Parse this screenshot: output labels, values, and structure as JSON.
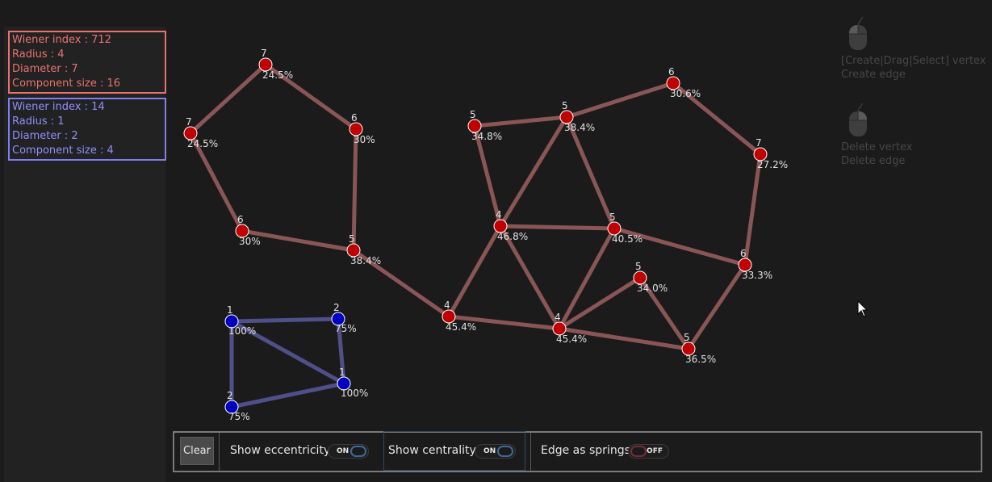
{
  "stats": {
    "red": {
      "wiener_index": "Wiener index : 712",
      "radius": "Radius : 4",
      "diameter": "Diameter : 7",
      "component_size": "Component size : 16",
      "color": "#e8736e"
    },
    "blue": {
      "wiener_index": "Wiener index : 14",
      "radius": "Radius : 1",
      "diameter": "Diameter : 2",
      "component_size": "Component size : 4",
      "color": "#8f8fff"
    }
  },
  "help": {
    "left_click_lines": [
      "[Create|Drag|Select] vertex",
      "Create edge"
    ],
    "right_click_lines": [
      "Delete vertex",
      "Delete edge"
    ]
  },
  "toolbar": {
    "clear_label": "Clear",
    "eccentricity": {
      "label": "Show eccentricity",
      "state": "ON"
    },
    "centrality": {
      "label": "Show centrality",
      "state": "ON"
    },
    "springs": {
      "label": "Edge as springs",
      "state": "OFF"
    }
  },
  "colors": {
    "red_vertex": "#c00000",
    "blue_vertex": "#0000c0",
    "red_edge": "#8a5555",
    "blue_edge": "#4f4f8a"
  },
  "graph": {
    "red": {
      "vertices": [
        {
          "id": "r1",
          "ecc": "7",
          "cent": "24.5%"
        },
        {
          "id": "r2",
          "ecc": "7",
          "cent": "24.5%"
        },
        {
          "id": "r3",
          "ecc": "6",
          "cent": "30%"
        },
        {
          "id": "r4",
          "ecc": "6",
          "cent": "30%"
        },
        {
          "id": "r5",
          "ecc": "5",
          "cent": "38.4%"
        },
        {
          "id": "r6",
          "ecc": "4",
          "cent": "45.4%"
        },
        {
          "id": "r7",
          "ecc": "4",
          "cent": "45.4%"
        },
        {
          "id": "r8",
          "ecc": "4",
          "cent": "46.8%"
        },
        {
          "id": "r9",
          "ecc": "5",
          "cent": "34.8%"
        },
        {
          "id": "r10",
          "ecc": "5",
          "cent": "38.4%"
        },
        {
          "id": "r11",
          "ecc": "5",
          "cent": "40.5%"
        },
        {
          "id": "r12",
          "ecc": "6",
          "cent": "30.6%"
        },
        {
          "id": "r13",
          "ecc": "7",
          "cent": "27.2%"
        },
        {
          "id": "r14",
          "ecc": "6",
          "cent": "33.3%"
        },
        {
          "id": "r15",
          "ecc": "5",
          "cent": "34.0%"
        },
        {
          "id": "r16",
          "ecc": "5",
          "cent": "36.5%"
        }
      ],
      "edges": [
        [
          "r1",
          "r2"
        ],
        [
          "r2",
          "r3"
        ],
        [
          "r3",
          "r5"
        ],
        [
          "r5",
          "r4"
        ],
        [
          "r4",
          "r1"
        ],
        [
          "r5",
          "r6"
        ],
        [
          "r6",
          "r7"
        ],
        [
          "r6",
          "r8"
        ],
        [
          "r8",
          "r7"
        ],
        [
          "r8",
          "r9"
        ],
        [
          "r8",
          "r10"
        ],
        [
          "r8",
          "r11"
        ],
        [
          "r9",
          "r10"
        ],
        [
          "r10",
          "r11"
        ],
        [
          "r10",
          "r12"
        ],
        [
          "r12",
          "r13"
        ],
        [
          "r13",
          "r14"
        ],
        [
          "r11",
          "r14"
        ],
        [
          "r11",
          "r7"
        ],
        [
          "r7",
          "r15"
        ],
        [
          "r7",
          "r16"
        ],
        [
          "r15",
          "r16"
        ],
        [
          "r16",
          "r14"
        ]
      ]
    },
    "blue": {
      "vertices": [
        {
          "id": "b1",
          "ecc": "1",
          "cent": "100%"
        },
        {
          "id": "b2",
          "ecc": "2",
          "cent": "75%"
        },
        {
          "id": "b3",
          "ecc": "1",
          "cent": "100%"
        },
        {
          "id": "b4",
          "ecc": "2",
          "cent": "75%"
        }
      ],
      "edges": [
        [
          "b1",
          "b2"
        ],
        [
          "b1",
          "b3"
        ],
        [
          "b2",
          "b3"
        ],
        [
          "b4",
          "b3"
        ],
        [
          "b1",
          "b4"
        ]
      ]
    }
  }
}
